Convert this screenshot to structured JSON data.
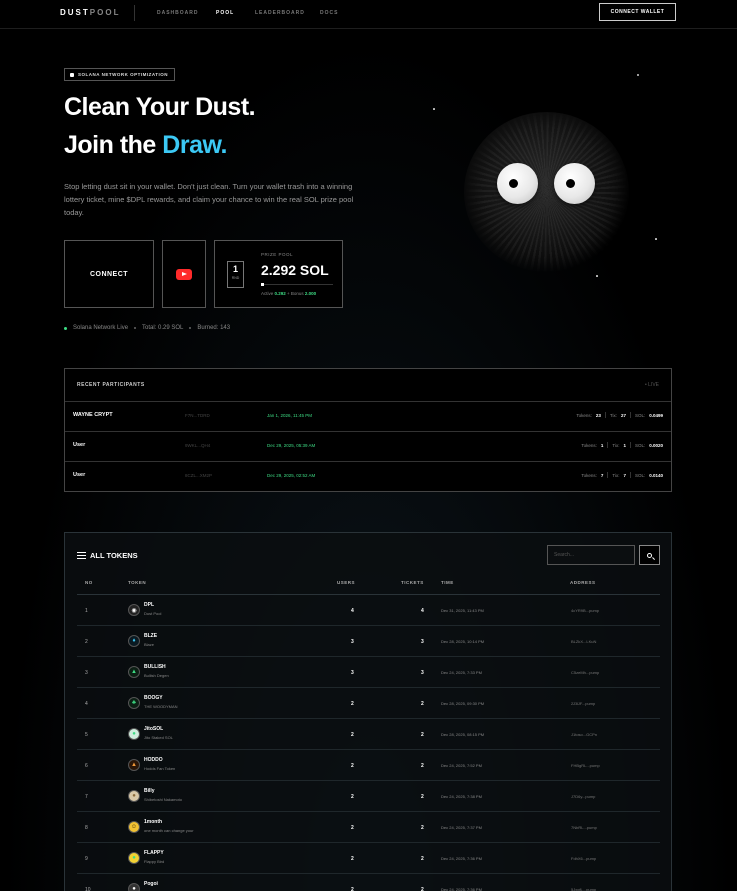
{
  "nav": {
    "logo_main": "DUST",
    "logo_accent": "POOL",
    "links": [
      "DASHBOARD",
      "POOL",
      "LEADERBOARD",
      "DOCS"
    ],
    "connect_wallet": "CONNECT WALLET"
  },
  "hero": {
    "badge": "SOLANA NETWORK OPTIMIZATION",
    "headline_line1": "Clean Your Dust.",
    "headline_line2_prefix": "Join the ",
    "headline_line2_accent": "Draw.",
    "description": "Stop letting dust sit in your wallet. Don't just clean. Turn your wallet trash into a winning lottery ticket, mine $DPL rewards, and claim your chance to win the real SOL prize pool today.",
    "accent_color": "#3cc9f5"
  },
  "actions": {
    "connect_label": "CONNECT",
    "youtube_icon": "youtube-icon"
  },
  "prize": {
    "round_number": "1",
    "round_label": "RND",
    "label": "PRIZE POOL",
    "value": "2.292 SOL",
    "progress_fraction": 0.04,
    "detail_prefix": "Active ",
    "detail_active": "0.292",
    "detail_mid": " + Bonus ",
    "detail_bonus": "2.000"
  },
  "status": {
    "network": "Solana Network Live",
    "total": "Total: 0.29 SOL",
    "burned": "Burned: 143"
  },
  "participants": {
    "title": "RECENT PARTICIPANTS",
    "count": "• LIVE",
    "rows": [
      {
        "name": "WAYNE CRYPT",
        "addr": "F7N...TDRD",
        "date": "Jan 1, 2026, 11:45 PM",
        "tokens_label": "Tokens:",
        "tokens": "23",
        "tix_label": "Tix:",
        "tix": "27",
        "sol_label": "SOL:",
        "sol": "0.0499"
      },
      {
        "name": "User",
        "addr": "9WKL...QH4",
        "date": "Dec 29, 2025, 05:39 AM",
        "tokens_label": "Tokens:",
        "tokens": "1",
        "tix_label": "Tix:",
        "tix": "1",
        "sol_label": "SOL:",
        "sol": "0.0020"
      },
      {
        "name": "User",
        "addr": "8CZL...XM2P",
        "date": "Dec 29, 2025, 02:52 AM",
        "tokens_label": "Tokens:",
        "tokens": "7",
        "tix_label": "Tix:",
        "tix": "7",
        "sol_label": "SOL:",
        "sol": "0.0140"
      }
    ]
  },
  "tokens": {
    "title": "ALL TOKENS",
    "search_placeholder": "Search...",
    "headers": {
      "no": "NO",
      "token": "TOKEN",
      "users": "USERS",
      "tickets": "TICKETS",
      "time": "TIME",
      "address": "ADDRESS"
    },
    "rows": [
      {
        "no": "1",
        "symbol": "DPL",
        "name": "Dust Pool",
        "users": "4",
        "tickets": "4",
        "time": "Dec 31, 2025, 11:43 PM",
        "address": "4cYR9B...pump",
        "icon_color": "#ffffff",
        "icon_bg": "#222222",
        "icon_glyph": "◉"
      },
      {
        "no": "2",
        "symbol": "BLZE",
        "name": "Blaze",
        "users": "3",
        "tickets": "3",
        "time": "Dec 28, 2025, 10:14 PM",
        "address": "BLZkX...LKuN",
        "icon_color": "#3cc9f5",
        "icon_bg": "#0a1a22",
        "icon_glyph": "♦"
      },
      {
        "no": "3",
        "symbol": "BULLISH",
        "name": "Bullish Degen",
        "users": "3",
        "tickets": "3",
        "time": "Dec 24, 2025, 7:33 PM",
        "address": "C5zeMh...pump",
        "icon_color": "#3ddc84",
        "icon_bg": "#0c1f14",
        "icon_glyph": "▲"
      },
      {
        "no": "4",
        "symbol": "BOOGY",
        "name": "THE WOODYMAN",
        "users": "2",
        "tickets": "2",
        "time": "Dec 28, 2025, 09:30 PM",
        "address": "2Z8JF...pump",
        "icon_color": "#3ddc84",
        "icon_bg": "#0c1f14",
        "icon_glyph": "♣"
      },
      {
        "no": "5",
        "symbol": "JitoSOL",
        "name": "Jito Staked SOL",
        "users": "2",
        "tickets": "2",
        "time": "Dec 28, 2025, 08:15 PM",
        "address": "J1toso...GCPn",
        "icon_color": "#3ddc84",
        "icon_bg": "#cfeede",
        "icon_glyph": "●"
      },
      {
        "no": "6",
        "symbol": "HODDO",
        "name": "Hodds Fan Token",
        "users": "2",
        "tickets": "2",
        "time": "Dec 24, 2025, 7:52 PM",
        "address": "FHBgRL...pump",
        "icon_color": "#f39a3a",
        "icon_bg": "#2a1608",
        "icon_glyph": "▲"
      },
      {
        "no": "7",
        "symbol": "Billy",
        "name": "Shibetoshi Nakamoto",
        "users": "2",
        "tickets": "2",
        "time": "Dec 24, 2025, 7:38 PM",
        "address": "J7D6y...pump",
        "icon_color": "#8a6a3a",
        "icon_bg": "#d8c8a8",
        "icon_glyph": "●"
      },
      {
        "no": "8",
        "symbol": "1month",
        "name": "one month can change your",
        "users": "2",
        "tickets": "2",
        "time": "Dec 24, 2025, 7:37 PM",
        "address": "7NbRL...pump",
        "icon_color": "#3a2a00",
        "icon_bg": "#f2c233",
        "icon_glyph": "☺"
      },
      {
        "no": "9",
        "symbol": "FLAPPY",
        "name": "Flappy Bird",
        "users": "2",
        "tickets": "2",
        "time": "Dec 24, 2025, 7:36 PM",
        "address": "FdhX6...pump",
        "icon_color": "#3ddc84",
        "icon_bg": "#f2d233",
        "icon_glyph": "●"
      },
      {
        "no": "10",
        "symbol": "Pogoi",
        "name": "Pogoi",
        "users": "2",
        "tickets": "2",
        "time": "Dec 24, 2025, 7:36 PM",
        "address": "5JxgfL...pump",
        "icon_color": "#ffffff",
        "icon_bg": "#333333",
        "icon_glyph": "●"
      }
    ]
  }
}
